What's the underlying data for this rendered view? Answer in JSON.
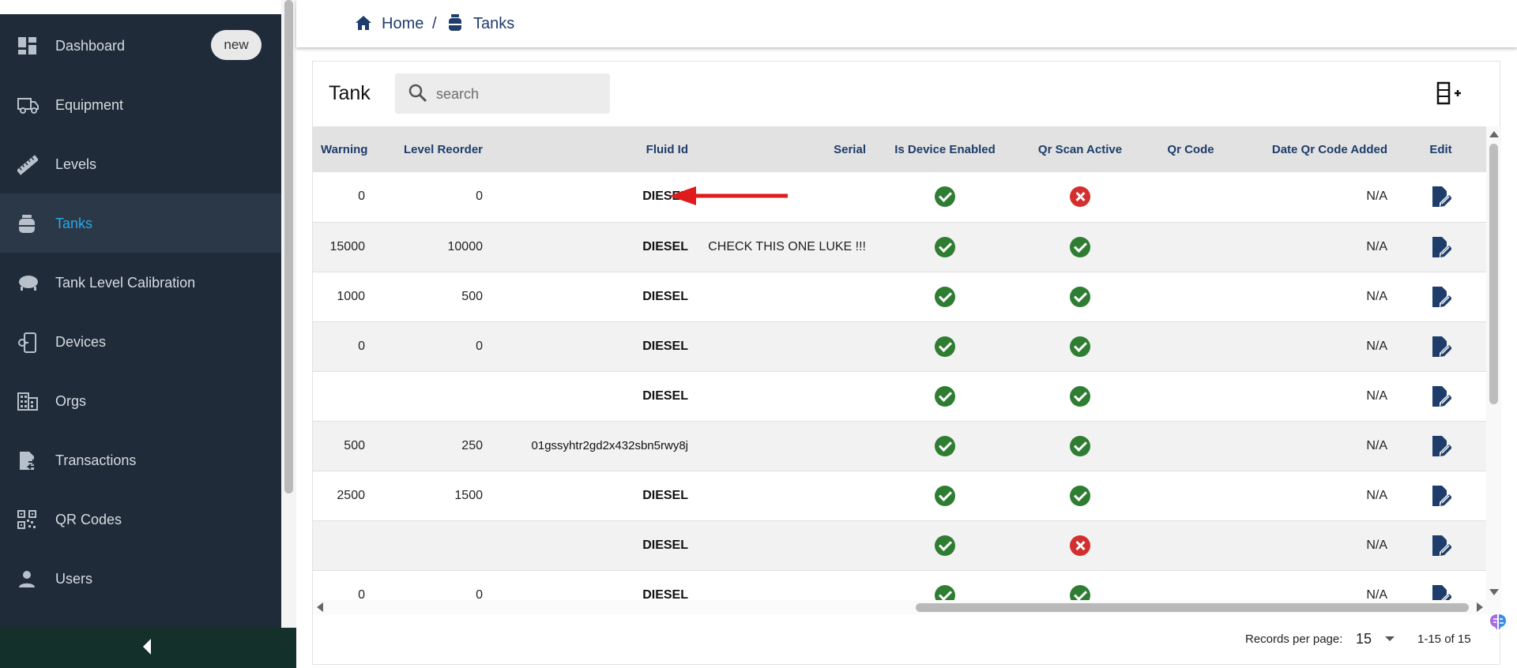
{
  "sidebar": {
    "items": [
      {
        "label": "Dashboard",
        "icon": "dashboard-icon",
        "badge": "new"
      },
      {
        "label": "Equipment",
        "icon": "truck-icon"
      },
      {
        "label": "Levels",
        "icon": "ruler-icon"
      },
      {
        "label": "Tanks",
        "icon": "tank-icon",
        "active": true
      },
      {
        "label": "Tank Level Calibration",
        "icon": "calibration-icon"
      },
      {
        "label": "Devices",
        "icon": "device-icon"
      },
      {
        "label": "Orgs",
        "icon": "building-icon"
      },
      {
        "label": "Transactions",
        "icon": "transactions-icon"
      },
      {
        "label": "QR Codes",
        "icon": "qr-code-icon"
      },
      {
        "label": "Users",
        "icon": "user-icon"
      }
    ]
  },
  "breadcrumb": {
    "home": "Home",
    "separator": "/",
    "current": "Tanks"
  },
  "card": {
    "title": "Tank",
    "search_placeholder": "search"
  },
  "table": {
    "columns": [
      "Warning",
      "Level Reorder",
      "Fluid Id",
      "Serial",
      "Is Device Enabled",
      "Qr Scan Active",
      "Qr Code",
      "Date Qr Code Added",
      "Edit"
    ],
    "rows": [
      {
        "warning": "0",
        "reorder": "0",
        "fluid": "DIESEL",
        "serial": "",
        "device_enabled": true,
        "qr_active": false,
        "qr_code": "",
        "date_added": "N/A"
      },
      {
        "warning": "15000",
        "reorder": "10000",
        "fluid": "DIESEL",
        "serial": "CHECK THIS ONE LUKE !!!",
        "device_enabled": true,
        "qr_active": true,
        "qr_code": "",
        "date_added": "N/A"
      },
      {
        "warning": "1000",
        "reorder": "500",
        "fluid": "DIESEL",
        "serial": "",
        "device_enabled": true,
        "qr_active": true,
        "qr_code": "",
        "date_added": "N/A"
      },
      {
        "warning": "0",
        "reorder": "0",
        "fluid": "DIESEL",
        "serial": "",
        "device_enabled": true,
        "qr_active": true,
        "qr_code": "",
        "date_added": "N/A"
      },
      {
        "warning": "",
        "reorder": "",
        "fluid": "DIESEL",
        "serial": "",
        "device_enabled": true,
        "qr_active": true,
        "qr_code": "",
        "date_added": "N/A"
      },
      {
        "warning": "500",
        "reorder": "250",
        "fluid": "01gssyhtr2gd2x432sbn5rwy8j",
        "serial": "",
        "device_enabled": true,
        "qr_active": true,
        "qr_code": "",
        "date_added": "N/A"
      },
      {
        "warning": "2500",
        "reorder": "1500",
        "fluid": "DIESEL",
        "serial": "",
        "device_enabled": true,
        "qr_active": true,
        "qr_code": "",
        "date_added": "N/A"
      },
      {
        "warning": "",
        "reorder": "",
        "fluid": "DIESEL",
        "serial": "",
        "device_enabled": true,
        "qr_active": false,
        "qr_code": "",
        "date_added": "N/A"
      },
      {
        "warning": "0",
        "reorder": "0",
        "fluid": "DIESEL",
        "serial": "",
        "device_enabled": true,
        "qr_active": true,
        "qr_code": "",
        "date_added": "N/A"
      }
    ]
  },
  "pagination": {
    "records_per_page_label": "Records per page:",
    "records_per_page": "15",
    "range": "1-15 of 15"
  },
  "colors": {
    "sidebar_bg": "#1f2b38",
    "active_item_text": "#2aa8e6",
    "header_text": "#1e3d6b",
    "status_ok": "#2e7d32",
    "status_bad": "#d32f2f",
    "annotation_arrow": "#e01b1b"
  }
}
